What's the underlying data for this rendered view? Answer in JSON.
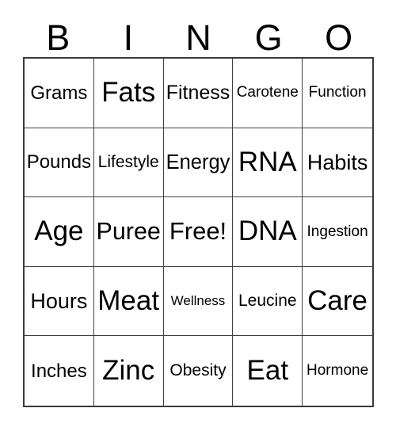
{
  "card": {
    "title_letters": [
      "B",
      "I",
      "N",
      "G",
      "O"
    ],
    "columns": 5,
    "rows": 5,
    "free_space_label": "Free!",
    "colors": {
      "background": "#ffffff",
      "text": "#000000",
      "grid_line": "#3f3f3f",
      "outer_border": "#3a3a3a"
    },
    "grid": [
      [
        {
          "label": "Grams",
          "size": "l"
        },
        {
          "label": "Fats",
          "size": "3xl"
        },
        {
          "label": "Fitness",
          "size": "xl"
        },
        {
          "label": "Carotene",
          "size": "s"
        },
        {
          "label": "Function",
          "size": "s"
        }
      ],
      [
        {
          "label": "Pounds",
          "size": "l"
        },
        {
          "label": "Lifestyle",
          "size": "m"
        },
        {
          "label": "Energy",
          "size": "xl"
        },
        {
          "label": "RNA",
          "size": "3xl"
        },
        {
          "label": "Habits",
          "size": "xl"
        }
      ],
      [
        {
          "label": "Age",
          "size": "3xl"
        },
        {
          "label": "Puree",
          "size": "xxl"
        },
        {
          "label": "Free!",
          "size": "xxl"
        },
        {
          "label": "DNA",
          "size": "3xl"
        },
        {
          "label": "Ingestion",
          "size": "s"
        }
      ],
      [
        {
          "label": "Hours",
          "size": "xl"
        },
        {
          "label": "Meat",
          "size": "3xl"
        },
        {
          "label": "Wellness",
          "size": "xs"
        },
        {
          "label": "Leucine",
          "size": "m"
        },
        {
          "label": "Care",
          "size": "3xl"
        }
      ],
      [
        {
          "label": "Inches",
          "size": "l"
        },
        {
          "label": "Zinc",
          "size": "3xl"
        },
        {
          "label": "Obesity",
          "size": "m"
        },
        {
          "label": "Eat",
          "size": "3xl"
        },
        {
          "label": "Hormone",
          "size": "s"
        }
      ]
    ]
  }
}
